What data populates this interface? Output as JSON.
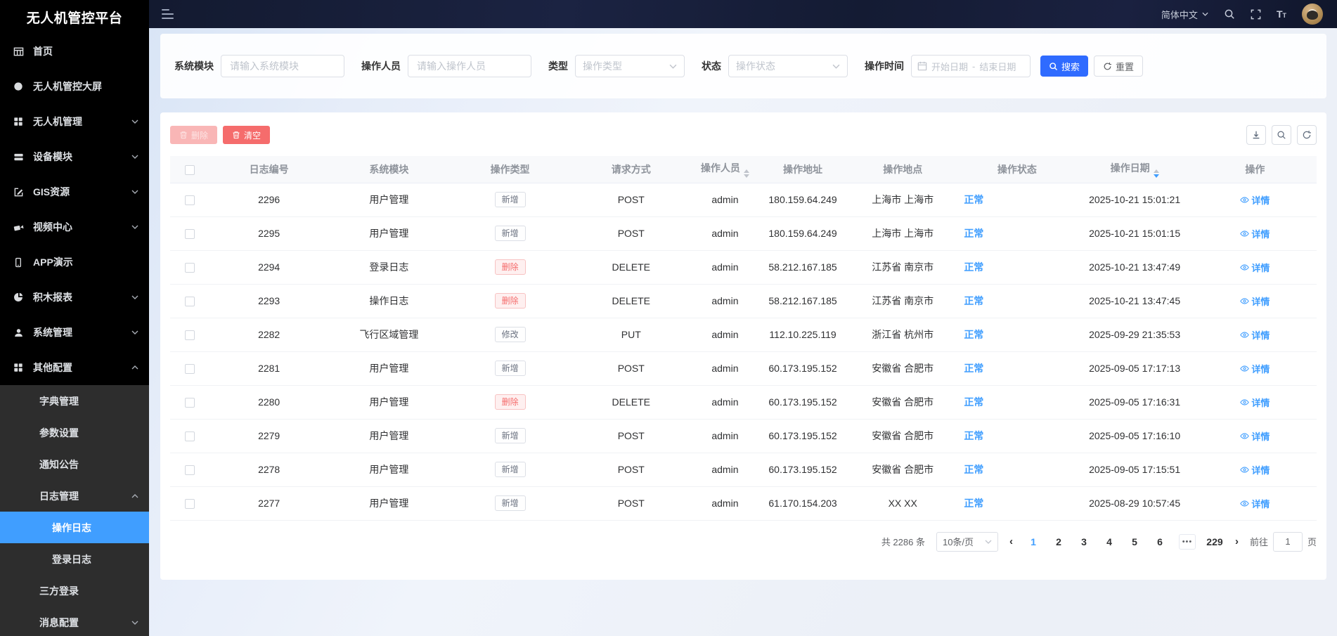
{
  "sidebar": {
    "logo": "无人机管控平台",
    "items": [
      {
        "label": "首页",
        "icon": "home-grid-icon",
        "level": 1
      },
      {
        "label": "无人机管控大屏",
        "icon": "screen-icon",
        "level": 1
      },
      {
        "label": "无人机管理",
        "icon": "drone-manage-icon",
        "level": 1,
        "chevron": "down"
      },
      {
        "label": "设备模块",
        "icon": "device-module-icon",
        "level": 1,
        "chevron": "down"
      },
      {
        "label": "GIS资源",
        "icon": "gis-edit-icon",
        "level": 1,
        "chevron": "down"
      },
      {
        "label": "视频中心",
        "icon": "video-camera-icon",
        "level": 1,
        "chevron": "down"
      },
      {
        "label": "APP演示",
        "icon": "phone-icon",
        "level": 1
      },
      {
        "label": "积木报表",
        "icon": "pie-report-icon",
        "level": 1,
        "chevron": "down"
      },
      {
        "label": "系统管理",
        "icon": "user-icon",
        "level": 1,
        "chevron": "down"
      },
      {
        "label": "其他配置",
        "icon": "apps-grid-icon",
        "level": 1,
        "chevron": "up"
      },
      {
        "label": "字典管理",
        "level": 2
      },
      {
        "label": "参数设置",
        "level": 2
      },
      {
        "label": "通知公告",
        "level": 2
      },
      {
        "label": "日志管理",
        "level": 2,
        "chevron": "up"
      },
      {
        "label": "操作日志",
        "level": 3,
        "active": true
      },
      {
        "label": "登录日志",
        "level": 3
      },
      {
        "label": "三方登录",
        "level": 2
      },
      {
        "label": "消息配置",
        "level": 2,
        "chevron": "down"
      }
    ]
  },
  "header": {
    "language": "简体中文",
    "icons": [
      "search-icon",
      "fullscreen-icon",
      "font-size-icon",
      "user-avatar"
    ],
    "font_icon_text": "T",
    "font_icon_text_small": "T"
  },
  "filters": {
    "fields": [
      {
        "label": "系统模块",
        "placeholder": "请输入系统模块",
        "type": "input"
      },
      {
        "label": "操作人员",
        "placeholder": "请输入操作人员",
        "type": "input"
      },
      {
        "label": "类型",
        "placeholder": "操作类型",
        "type": "select"
      },
      {
        "label": "状态",
        "placeholder": "操作状态",
        "type": "select"
      },
      {
        "label": "操作时间",
        "start": "开始日期",
        "separator": "-",
        "end": "结束日期",
        "type": "daterange"
      }
    ],
    "search_label": "搜索",
    "reset_label": "重置"
  },
  "toolbar": {
    "delete_label": "删除",
    "clear_label": "清空",
    "icons": [
      "download-icon",
      "search-icon",
      "refresh-icon"
    ]
  },
  "table": {
    "columns": [
      {
        "label": "",
        "type": "checkbox"
      },
      {
        "label": "日志编号"
      },
      {
        "label": "系统模块"
      },
      {
        "label": "操作类型"
      },
      {
        "label": "请求方式"
      },
      {
        "label": "操作人员",
        "sortable": true
      },
      {
        "label": "操作地址"
      },
      {
        "label": "操作地点"
      },
      {
        "label": "操作状态"
      },
      {
        "label": "操作日期",
        "sortable": true,
        "active_sort": "desc"
      },
      {
        "label": "操作"
      }
    ],
    "rows": [
      {
        "id": "2296",
        "module": "用户管理",
        "type": "新增",
        "method": "POST",
        "operator": "admin",
        "address": "180.159.64.249",
        "location": "上海市 上海市",
        "status": "正常",
        "date": "2025-10-21 15:01:21",
        "action": "详情"
      },
      {
        "id": "2295",
        "module": "用户管理",
        "type": "新增",
        "method": "POST",
        "operator": "admin",
        "address": "180.159.64.249",
        "location": "上海市 上海市",
        "status": "正常",
        "date": "2025-10-21 15:01:15",
        "action": "详情"
      },
      {
        "id": "2294",
        "module": "登录日志",
        "type": "删除",
        "method": "DELETE",
        "operator": "admin",
        "address": "58.212.167.185",
        "location": "江苏省 南京市",
        "status": "正常",
        "date": "2025-10-21 13:47:49",
        "action": "详情"
      },
      {
        "id": "2293",
        "module": "操作日志",
        "type": "删除",
        "method": "DELETE",
        "operator": "admin",
        "address": "58.212.167.185",
        "location": "江苏省 南京市",
        "status": "正常",
        "date": "2025-10-21 13:47:45",
        "action": "详情"
      },
      {
        "id": "2282",
        "module": "飞行区域管理",
        "type": "修改",
        "method": "PUT",
        "operator": "admin",
        "address": "112.10.225.119",
        "location": "浙江省 杭州市",
        "status": "正常",
        "date": "2025-09-29 21:35:53",
        "action": "详情"
      },
      {
        "id": "2281",
        "module": "用户管理",
        "type": "新增",
        "method": "POST",
        "operator": "admin",
        "address": "60.173.195.152",
        "location": "安徽省 合肥市",
        "status": "正常",
        "date": "2025-09-05 17:17:13",
        "action": "详情"
      },
      {
        "id": "2280",
        "module": "用户管理",
        "type": "删除",
        "method": "DELETE",
        "operator": "admin",
        "address": "60.173.195.152",
        "location": "安徽省 合肥市",
        "status": "正常",
        "date": "2025-09-05 17:16:31",
        "action": "详情"
      },
      {
        "id": "2279",
        "module": "用户管理",
        "type": "新增",
        "method": "POST",
        "operator": "admin",
        "address": "60.173.195.152",
        "location": "安徽省 合肥市",
        "status": "正常",
        "date": "2025-09-05 17:16:10",
        "action": "详情"
      },
      {
        "id": "2278",
        "module": "用户管理",
        "type": "新增",
        "method": "POST",
        "operator": "admin",
        "address": "60.173.195.152",
        "location": "安徽省 合肥市",
        "status": "正常",
        "date": "2025-09-05 17:15:51",
        "action": "详情"
      },
      {
        "id": "2277",
        "module": "用户管理",
        "type": "新增",
        "method": "POST",
        "operator": "admin",
        "address": "61.170.154.203",
        "location": "XX XX",
        "status": "正常",
        "date": "2025-08-29 10:57:45",
        "action": "详情"
      }
    ],
    "tag_styles": {
      "新增": "info",
      "修改": "info",
      "删除": "danger"
    }
  },
  "pagination": {
    "total_text": "共 2286 条",
    "page_size": "10条/页",
    "prev": "‹",
    "next": "›",
    "pages": [
      "1",
      "2",
      "3",
      "4",
      "5",
      "6"
    ],
    "active_page": "1",
    "ellipsis": "•••",
    "last_page": "229",
    "goto_label": "前往",
    "goto_value": "1",
    "goto_suffix": "页"
  },
  "colors": {
    "primary_button": "#2f6bff",
    "link": "#409eff",
    "danger": "#f56c6c",
    "danger_disabled": "#f9b6b6",
    "sidebar_bg": "#000000",
    "submenu_bg": "#2d2d2d",
    "sidebar_active": "#409eff",
    "topbar_bg": "#161d36",
    "content_bg": "#edf0f7"
  }
}
